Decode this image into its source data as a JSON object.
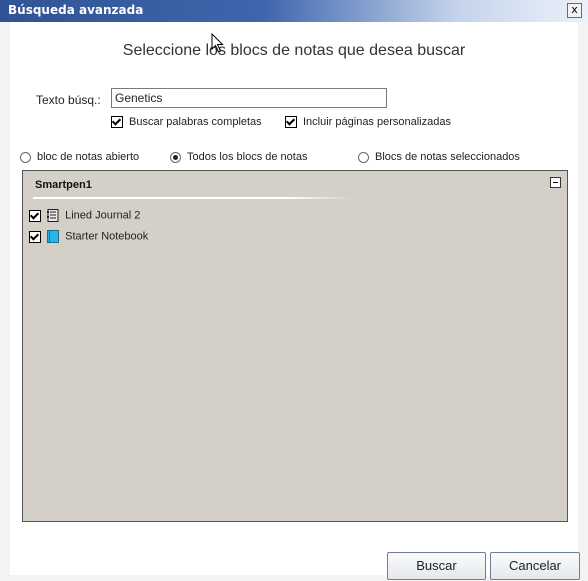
{
  "window": {
    "title": "Búsqueda avanzada",
    "close_label": "x"
  },
  "heading": "Seleccione los blocs de notas que desea buscar",
  "search": {
    "label": "Texto búsq.:",
    "value": "Genetics"
  },
  "options": {
    "whole_words": {
      "label": "Buscar palabras completas",
      "checked": true
    },
    "custom_pages": {
      "label": "Incluir páginas personalizadas",
      "checked": true
    }
  },
  "scope": {
    "open_notebook": {
      "label": "bloc de notas abierto",
      "selected": false
    },
    "all_notebooks": {
      "label": "Todos los blocs de notas",
      "selected": true
    },
    "selected_notebooks": {
      "label": "Blocs de notas seleccionados",
      "selected": false
    }
  },
  "group": {
    "title": "Smartpen1",
    "notebooks": [
      {
        "label": "Lined Journal 2",
        "checked": true,
        "icon": "lined-journal-icon"
      },
      {
        "label": "Starter Notebook",
        "checked": true,
        "icon": "starter-notebook-icon",
        "color": "#2bb6ea"
      }
    ]
  },
  "buttons": {
    "search": "Buscar",
    "cancel": "Cancelar"
  }
}
